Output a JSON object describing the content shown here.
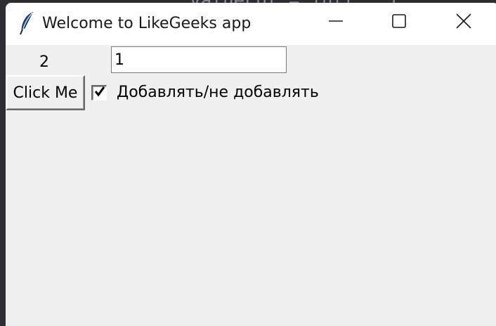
{
  "background_code": "valueLbl = int(...)",
  "window": {
    "title": "Welcome to LikeGeeks app",
    "controls": {
      "minimize_icon": "minimize-icon",
      "maximize_icon": "maximize-icon",
      "close_icon": "close-icon"
    }
  },
  "main": {
    "counter_label": "2",
    "entry_value": "1",
    "button_label": "Click Me",
    "checkbox": {
      "checked": true,
      "label": "Добавлять/не добавлять"
    }
  },
  "colors": {
    "window_bg": "#f0f0f0",
    "titlebar_bg": "#ffffff",
    "desktop_bg": "#2b2d31"
  }
}
